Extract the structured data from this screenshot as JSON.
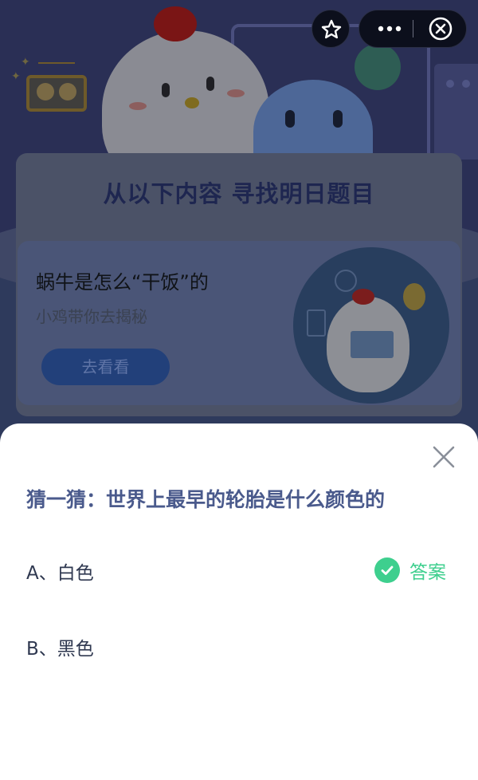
{
  "background": {
    "hero_title": "从以下内容 寻找明日题目",
    "article": {
      "title": "蜗牛是怎么“干饭”的",
      "subtitle": "小鸡带你去揭秘",
      "button_label": "去看看"
    }
  },
  "top_controls": {
    "star_icon": "star-icon",
    "more_icon": "more-horizontal-icon",
    "close_icon": "close-circle-icon"
  },
  "sheet": {
    "question": "猜一猜：世界上最早的轮胎是什么颜色的",
    "options": [
      {
        "label": "A、白色",
        "answer_label": "答案"
      },
      {
        "label": "B、黑色"
      }
    ],
    "accent_color": "#3ecf8e"
  }
}
